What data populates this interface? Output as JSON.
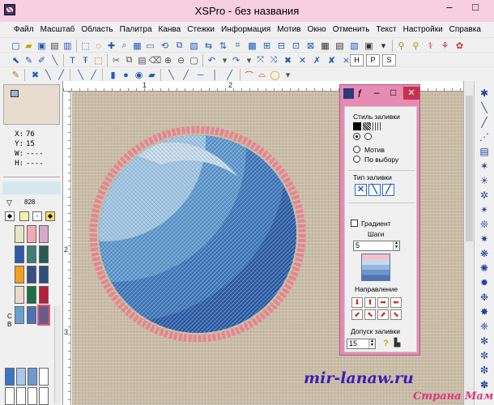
{
  "window": {
    "title": "XSPro - без названия",
    "min_glyph": "–",
    "max_glyph": "□"
  },
  "menu": [
    "Файл",
    "Масштаб",
    "Область",
    "Палитра",
    "Канва",
    "Стежки",
    "Информация",
    "Мотив",
    "Окно",
    "Отменить",
    "Текст",
    "Настройки",
    "Справка"
  ],
  "toolbar3_badges": [
    "H",
    "P",
    "S"
  ],
  "toolbar2_badges": [
    "H",
    "P",
    "S"
  ],
  "ruler": {
    "marks": [
      "1",
      "2"
    ],
    "left_marks": [
      "2",
      "3"
    ]
  },
  "coords": [
    {
      "label": "X:",
      "value": "76"
    },
    {
      "label": "Y:",
      "value": "15"
    },
    {
      "label": "W:",
      "value": "----"
    },
    {
      "label": "H:",
      "value": "----"
    }
  ],
  "palette": {
    "number": "828",
    "label_c": "C",
    "label_b": "B",
    "swatches": [
      "#e9e4c8",
      "#f5a8b4",
      "#d9a9c9",
      "#2f58a8",
      "#3e7f74",
      "#2b5a52",
      "#f0a020",
      "#3a4d84",
      "#2e4f7b",
      "#e7dccd",
      "#1f6f45",
      "#b5203c",
      "#6b9fd0",
      "#4b72b4",
      "#6a5a8a"
    ]
  },
  "dialog": {
    "title": "f",
    "close_glyph": "✕",
    "fill_style_label": "Стиль заливки",
    "motif_label": "Мотив",
    "by_choice_label": "По выбору",
    "fill_type_label": "Тип заливки",
    "gradient_label": "Градиент",
    "steps_label": "Шаги",
    "steps_value": "5",
    "direction_label": "Направление",
    "tolerance_label": "Допуск заливки",
    "tolerance_value": "15",
    "help_glyph": "?"
  },
  "colors": {
    "outline": "#e8848f",
    "ring": [
      "#9fc6e5",
      "#5c98cf",
      "#3e78bd",
      "#2b5ea8"
    ],
    "light": "#c4dcef"
  },
  "watermark": {
    "line1": "mir-lanaw.ru",
    "line2": "Страна Мам"
  }
}
